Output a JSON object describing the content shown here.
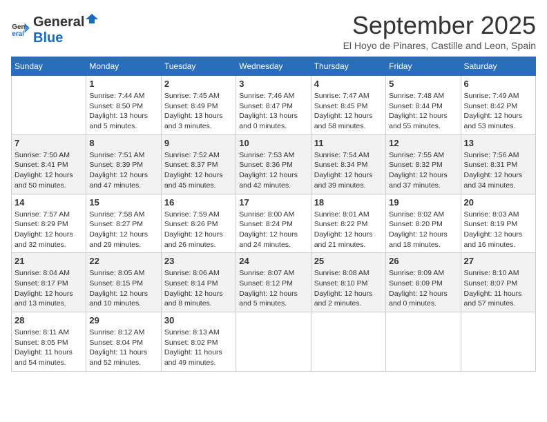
{
  "logo": {
    "general": "General",
    "blue": "Blue"
  },
  "title": "September 2025",
  "subtitle": "El Hoyo de Pinares, Castille and Leon, Spain",
  "headers": [
    "Sunday",
    "Monday",
    "Tuesday",
    "Wednesday",
    "Thursday",
    "Friday",
    "Saturday"
  ],
  "weeks": [
    [
      {
        "day": "",
        "info": ""
      },
      {
        "day": "1",
        "info": "Sunrise: 7:44 AM\nSunset: 8:50 PM\nDaylight: 13 hours\nand 5 minutes."
      },
      {
        "day": "2",
        "info": "Sunrise: 7:45 AM\nSunset: 8:49 PM\nDaylight: 13 hours\nand 3 minutes."
      },
      {
        "day": "3",
        "info": "Sunrise: 7:46 AM\nSunset: 8:47 PM\nDaylight: 13 hours\nand 0 minutes."
      },
      {
        "day": "4",
        "info": "Sunrise: 7:47 AM\nSunset: 8:45 PM\nDaylight: 12 hours\nand 58 minutes."
      },
      {
        "day": "5",
        "info": "Sunrise: 7:48 AM\nSunset: 8:44 PM\nDaylight: 12 hours\nand 55 minutes."
      },
      {
        "day": "6",
        "info": "Sunrise: 7:49 AM\nSunset: 8:42 PM\nDaylight: 12 hours\nand 53 minutes."
      }
    ],
    [
      {
        "day": "7",
        "info": "Sunrise: 7:50 AM\nSunset: 8:41 PM\nDaylight: 12 hours\nand 50 minutes."
      },
      {
        "day": "8",
        "info": "Sunrise: 7:51 AM\nSunset: 8:39 PM\nDaylight: 12 hours\nand 47 minutes."
      },
      {
        "day": "9",
        "info": "Sunrise: 7:52 AM\nSunset: 8:37 PM\nDaylight: 12 hours\nand 45 minutes."
      },
      {
        "day": "10",
        "info": "Sunrise: 7:53 AM\nSunset: 8:36 PM\nDaylight: 12 hours\nand 42 minutes."
      },
      {
        "day": "11",
        "info": "Sunrise: 7:54 AM\nSunset: 8:34 PM\nDaylight: 12 hours\nand 39 minutes."
      },
      {
        "day": "12",
        "info": "Sunrise: 7:55 AM\nSunset: 8:32 PM\nDaylight: 12 hours\nand 37 minutes."
      },
      {
        "day": "13",
        "info": "Sunrise: 7:56 AM\nSunset: 8:31 PM\nDaylight: 12 hours\nand 34 minutes."
      }
    ],
    [
      {
        "day": "14",
        "info": "Sunrise: 7:57 AM\nSunset: 8:29 PM\nDaylight: 12 hours\nand 32 minutes."
      },
      {
        "day": "15",
        "info": "Sunrise: 7:58 AM\nSunset: 8:27 PM\nDaylight: 12 hours\nand 29 minutes."
      },
      {
        "day": "16",
        "info": "Sunrise: 7:59 AM\nSunset: 8:26 PM\nDaylight: 12 hours\nand 26 minutes."
      },
      {
        "day": "17",
        "info": "Sunrise: 8:00 AM\nSunset: 8:24 PM\nDaylight: 12 hours\nand 24 minutes."
      },
      {
        "day": "18",
        "info": "Sunrise: 8:01 AM\nSunset: 8:22 PM\nDaylight: 12 hours\nand 21 minutes."
      },
      {
        "day": "19",
        "info": "Sunrise: 8:02 AM\nSunset: 8:20 PM\nDaylight: 12 hours\nand 18 minutes."
      },
      {
        "day": "20",
        "info": "Sunrise: 8:03 AM\nSunset: 8:19 PM\nDaylight: 12 hours\nand 16 minutes."
      }
    ],
    [
      {
        "day": "21",
        "info": "Sunrise: 8:04 AM\nSunset: 8:17 PM\nDaylight: 12 hours\nand 13 minutes."
      },
      {
        "day": "22",
        "info": "Sunrise: 8:05 AM\nSunset: 8:15 PM\nDaylight: 12 hours\nand 10 minutes."
      },
      {
        "day": "23",
        "info": "Sunrise: 8:06 AM\nSunset: 8:14 PM\nDaylight: 12 hours\nand 8 minutes."
      },
      {
        "day": "24",
        "info": "Sunrise: 8:07 AM\nSunset: 8:12 PM\nDaylight: 12 hours\nand 5 minutes."
      },
      {
        "day": "25",
        "info": "Sunrise: 8:08 AM\nSunset: 8:10 PM\nDaylight: 12 hours\nand 2 minutes."
      },
      {
        "day": "26",
        "info": "Sunrise: 8:09 AM\nSunset: 8:09 PM\nDaylight: 12 hours\nand 0 minutes."
      },
      {
        "day": "27",
        "info": "Sunrise: 8:10 AM\nSunset: 8:07 PM\nDaylight: 11 hours\nand 57 minutes."
      }
    ],
    [
      {
        "day": "28",
        "info": "Sunrise: 8:11 AM\nSunset: 8:05 PM\nDaylight: 11 hours\nand 54 minutes."
      },
      {
        "day": "29",
        "info": "Sunrise: 8:12 AM\nSunset: 8:04 PM\nDaylight: 11 hours\nand 52 minutes."
      },
      {
        "day": "30",
        "info": "Sunrise: 8:13 AM\nSunset: 8:02 PM\nDaylight: 11 hours\nand 49 minutes."
      },
      {
        "day": "",
        "info": ""
      },
      {
        "day": "",
        "info": ""
      },
      {
        "day": "",
        "info": ""
      },
      {
        "day": "",
        "info": ""
      }
    ]
  ]
}
